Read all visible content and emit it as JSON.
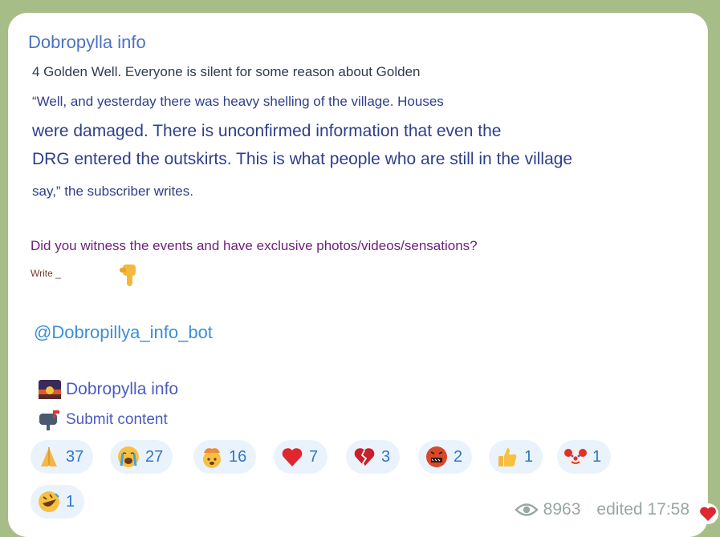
{
  "channel": {
    "name": "Dobropylla info"
  },
  "post": {
    "lines": [
      "4 Golden Well. Everyone is silent for some reason about Golden",
      "“Well, and yesterday there was heavy shelling of the village. Houses",
      "were damaged. There is unconfirmed information that even the",
      "DRG entered the outskirts. This is what people who are still in the village",
      "say,” the subscriber writes."
    ],
    "cta": "Did you witness the events and have exclusive photos/videos/sensations?",
    "write_label": "Write _",
    "bot_link": "@Dobropillya_info_bot",
    "footer_links": [
      {
        "label": "Dobropylla info",
        "icon": "sunset-image-icon"
      },
      {
        "label": "Submit content",
        "icon": "mailbox-icon"
      }
    ]
  },
  "reactions": [
    {
      "emoji": "praying-hands",
      "count": "37"
    },
    {
      "emoji": "loudly-crying-face",
      "count": "27"
    },
    {
      "emoji": "exploding-head",
      "count": "16"
    },
    {
      "emoji": "red-heart",
      "count": "7"
    },
    {
      "emoji": "broken-heart",
      "count": "3"
    },
    {
      "emoji": "cursing-face",
      "count": "2"
    },
    {
      "emoji": "thumbs-up",
      "count": "1"
    },
    {
      "emoji": "clown-face",
      "count": "1"
    },
    {
      "emoji": "rolling-on-floor-laughing",
      "count": "1"
    }
  ],
  "meta": {
    "views": "8963",
    "edited": "edited 17:58",
    "icon": "eye-icon",
    "own_reaction": "red-heart"
  },
  "colors": {
    "link": "#3c8ed8",
    "reaction_bg": "#eaf3fb",
    "wallpaper": "#a6bd87"
  }
}
